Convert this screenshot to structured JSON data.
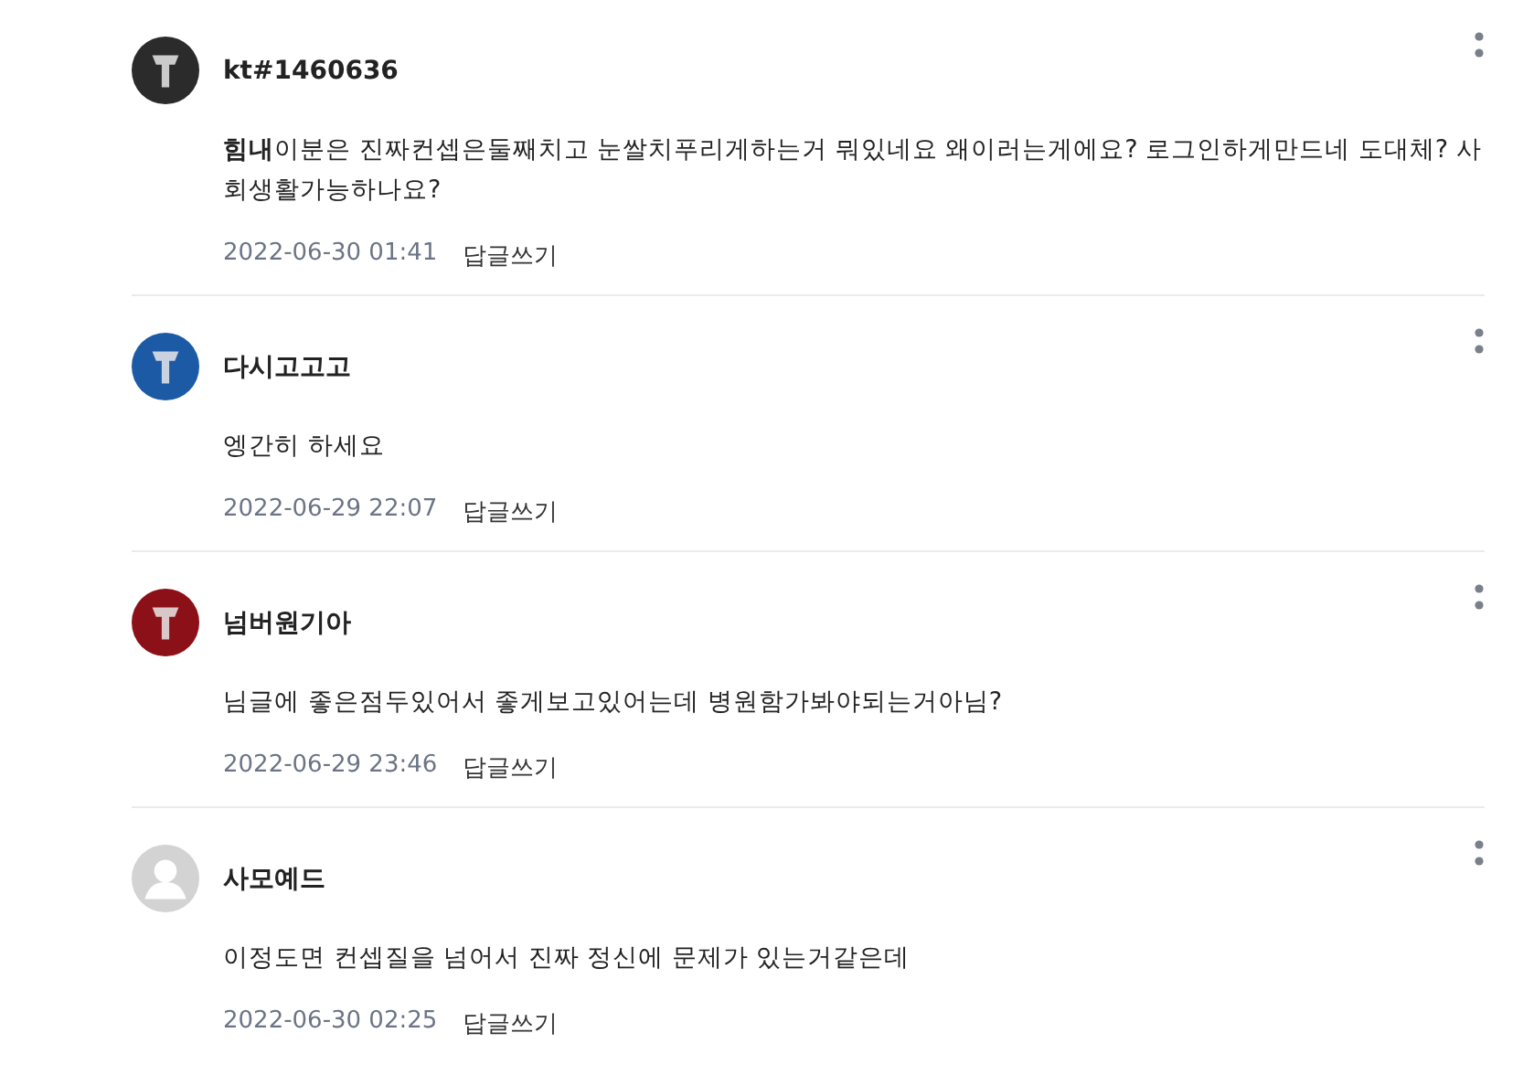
{
  "comments": [
    {
      "author": "kt#1460636",
      "avatar": {
        "kind": "logo",
        "color": "#2b2b2b"
      },
      "text": "**힘내**이분은 진짜컨셉은둘째치고 눈쌀치푸리게하는거 뭐있네요 왜이러는게에요? 로그인하게만드네 도대체? 사회생활가능하나요?",
      "date": "2022-06-30 01:41",
      "reply": "답글쓰기"
    },
    {
      "author": "다시고고고",
      "avatar": {
        "kind": "logo",
        "color": "#1c5aa6"
      },
      "text": "엥간히 하세요",
      "date": "2022-06-29 22:07",
      "reply": "답글쓰기"
    },
    {
      "author": "넘버원기아",
      "avatar": {
        "kind": "logo",
        "color": "#8c1018"
      },
      "text": "님글에 좋은점두있어서 좋게보고있어는데 병원함가봐야되는거아님?",
      "date": "2022-06-29 23:46",
      "reply": "답글쓰기"
    },
    {
      "author": "사모예드",
      "avatar": {
        "kind": "default",
        "color": "#d3d3d3"
      },
      "text": "이정도면 컨셉질을 넘어서 진짜 정신에 문제가 있는거같은데",
      "date": "2022-06-30 02:25",
      "reply": "답글쓰기"
    }
  ]
}
